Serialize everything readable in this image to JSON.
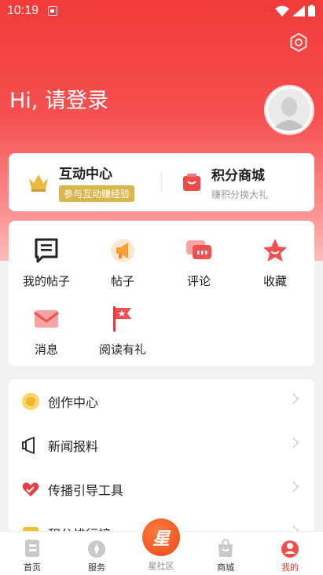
{
  "status": {
    "time": "10:19"
  },
  "header": {
    "greeting": "Hi, 请登录"
  },
  "promo": {
    "left": {
      "title": "互动中心",
      "badge": "参与互动赚经验"
    },
    "right": {
      "title": "积分商城",
      "subtitle": "赚积分换大礼"
    }
  },
  "shortcuts": [
    {
      "label": "我的帖子",
      "icon": "document-icon"
    },
    {
      "label": "帖子",
      "icon": "megaphone-icon"
    },
    {
      "label": "评论",
      "icon": "comment-icon"
    },
    {
      "label": "收藏",
      "icon": "star-icon"
    },
    {
      "label": "消息",
      "icon": "envelope-icon"
    },
    {
      "label": "阅读有礼",
      "icon": "flag-icon"
    }
  ],
  "menu": [
    {
      "label": "创作中心",
      "icon": "sun-icon"
    },
    {
      "label": "新闻报料",
      "icon": "speaker-icon"
    },
    {
      "label": "传播引导工具",
      "icon": "heart-icon"
    },
    {
      "label": "积分排行榜",
      "icon": "trophy-icon"
    }
  ],
  "tabs": [
    {
      "label": "首页",
      "icon": "home-icon"
    },
    {
      "label": "服务",
      "icon": "compass-icon"
    },
    {
      "label": "星社区",
      "icon": "star-community-icon",
      "glyph": "星"
    },
    {
      "label": "商城",
      "icon": "bag-icon"
    },
    {
      "label": "我的",
      "icon": "profile-icon"
    }
  ],
  "colors": {
    "primary": "#e83a30",
    "gold": "#d9b54e"
  }
}
